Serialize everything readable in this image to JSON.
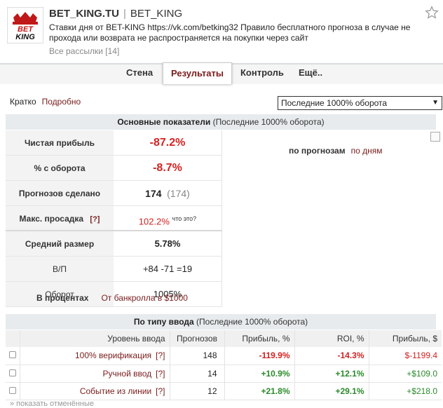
{
  "header": {
    "name": "BET_KING.TU",
    "handle": "BET_KING",
    "description": "Ставки дня от BET-KING https://vk.com/betking32 Правило бесплатного прогноза в случае не прохода или возврата не распространяется на покупки через сайт",
    "all_mailings": "Все рассылки [14]"
  },
  "tabs": [
    "Стена",
    "Результаты",
    "Контроль",
    "Ещё.."
  ],
  "mode": {
    "short": "Кратко",
    "detailed": "Подробно",
    "select_value": "Последние 1000% оборота"
  },
  "main": {
    "head_title": "Основные показатели",
    "head_sub": "(Последние 1000% оборота)",
    "rows": [
      {
        "label": "Чистая прибыль",
        "value": "-87.2%"
      },
      {
        "label": "% с оборота",
        "value": "-8.7%"
      },
      {
        "label": "Прогнозов сделано",
        "value": "174",
        "value2": "(174)"
      },
      {
        "label": "Макс. просадка",
        "hint": "[?]",
        "value": "102.2%",
        "note": "что это?"
      },
      {
        "label": "Средний размер",
        "value": "5.78%"
      },
      {
        "label": "В/П",
        "value": "+84 -71 =19"
      },
      {
        "label": "Оборот",
        "value": "1005%"
      }
    ],
    "by_forecasts": "по прогнозам",
    "by_days": "по дням",
    "in_percent": "В процентах",
    "from_bankroll": "От банкролла в $1000"
  },
  "by_type": {
    "head_title": "По типу ввода",
    "head_sub": "(Последние 1000% оборота)",
    "columns": [
      "Уровень ввода",
      "Прогнозов",
      "Прибыль, %",
      "ROI, %",
      "Прибыль, $"
    ],
    "rows": [
      {
        "level": "100% верификация",
        "hint": "[?]",
        "count": "148",
        "profit_pct": "-119.9%",
        "roi": "-14.3%",
        "profit_usd": "$-1199.4"
      },
      {
        "level": "Ручной ввод",
        "hint": "[?]",
        "count": "14",
        "profit_pct": "+10.9%",
        "roi": "+12.1%",
        "profit_usd": "+$109.0"
      },
      {
        "level": "Событие из линии",
        "hint": "[?]",
        "count": "12",
        "profit_pct": "+21.8%",
        "roi": "+29.1%",
        "profit_usd": "+$218.0"
      }
    ]
  },
  "footer": "» показать отменённые"
}
